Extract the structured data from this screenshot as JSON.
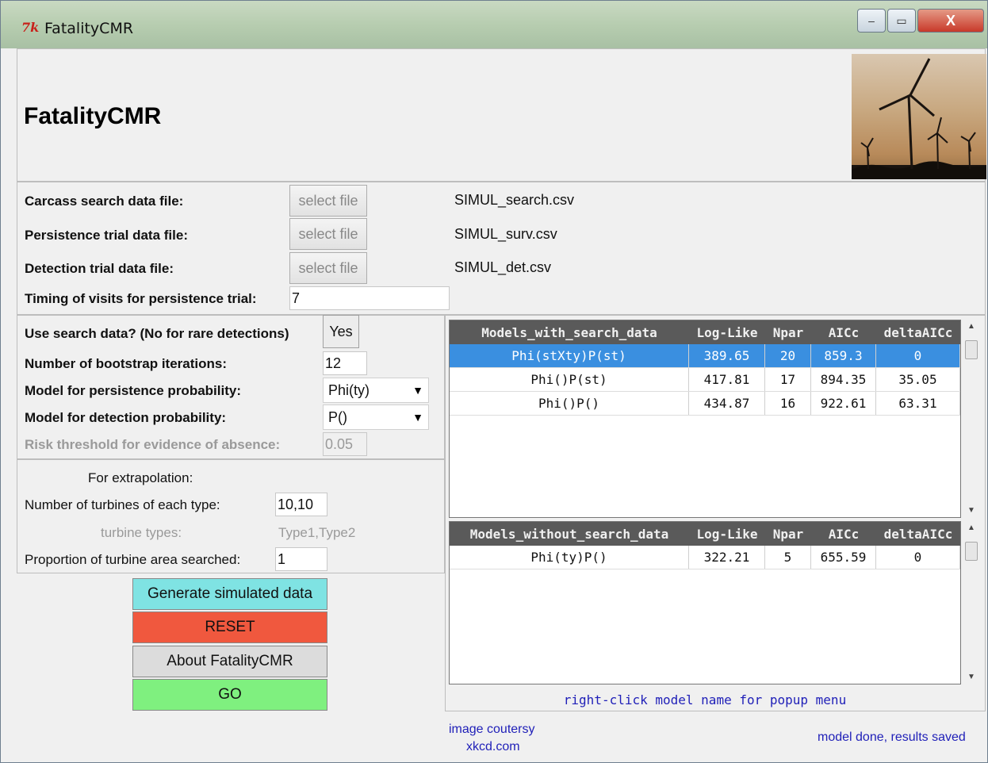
{
  "window": {
    "title": "FatalityCMR",
    "icon_glyph": "7k",
    "minimize_glyph": "–",
    "maximize_glyph": "▭",
    "close_glyph": "X"
  },
  "header": {
    "heading": "FatalityCMR"
  },
  "files": {
    "carcass_label": "Carcass search data file:",
    "carcass_button": "select file",
    "carcass_file": "SIMUL_search.csv",
    "persistence_label": "Persistence trial data file:",
    "persistence_button": "select file",
    "persistence_file": "SIMUL_surv.csv",
    "detection_label": "Detection trial data file:",
    "detection_button": "select file",
    "detection_file": "SIMUL_det.csv",
    "timing_label": "Timing of visits for persistence trial:",
    "timing_value": "7"
  },
  "options": {
    "use_search_label": "Use search data? (No for rare detections)",
    "use_search_value": "Yes",
    "bootstrap_label": "Number of bootstrap iterations:",
    "bootstrap_value": "12",
    "persistence_model_label": "Model for persistence probability:",
    "persistence_model_value": "Phi(ty)",
    "detection_model_label": "Model for detection probability:",
    "detection_model_value": "P()",
    "risk_label": "Risk threshold for evidence of absence:",
    "risk_value": "0.05",
    "dropdown_arrow": "▼"
  },
  "extrapolation": {
    "heading": "For extrapolation:",
    "turbines_label": "Number of turbines of each type:",
    "turbines_value": "10,10",
    "types_label": "turbine types:",
    "types_value": "Type1,Type2",
    "proportion_label": "Proportion of turbine area searched:",
    "proportion_value": "1"
  },
  "actions": {
    "generate": "Generate simulated data",
    "reset": "RESET",
    "about": "About FatalityCMR",
    "go": "GO"
  },
  "colors": {
    "generate_bg": "#7fe3e3",
    "reset_bg": "#f0583e",
    "about_bg": "#dcdcdc",
    "go_bg": "#7ff07f",
    "selected_row": "#3a8fe0"
  },
  "table_with": {
    "headers": [
      "Models_with_search_data",
      "Log-Like",
      "Npar",
      "AICc",
      "deltaAICc"
    ],
    "rows": [
      [
        "Phi(stXty)P(st)",
        "389.65",
        "20",
        "859.3",
        "0"
      ],
      [
        "Phi()P(st)",
        "417.81",
        "17",
        "894.35",
        "35.05"
      ],
      [
        "Phi()P()",
        "434.87",
        "16",
        "922.61",
        "63.31"
      ]
    ],
    "selected_index": 0
  },
  "table_without": {
    "headers": [
      "Models_without_search_data",
      "Log-Like",
      "Npar",
      "AICc",
      "deltaAICc"
    ],
    "rows": [
      [
        "Phi(ty)P()",
        "322.21",
        "5",
        "655.59",
        "0"
      ]
    ]
  },
  "scroll": {
    "up": "▲",
    "down": "▼"
  },
  "footer": {
    "hint": "right-click model name for popup menu",
    "credit_line1": "image coutersy",
    "credit_line2": "xkcd.com",
    "status": "model done, results saved"
  }
}
